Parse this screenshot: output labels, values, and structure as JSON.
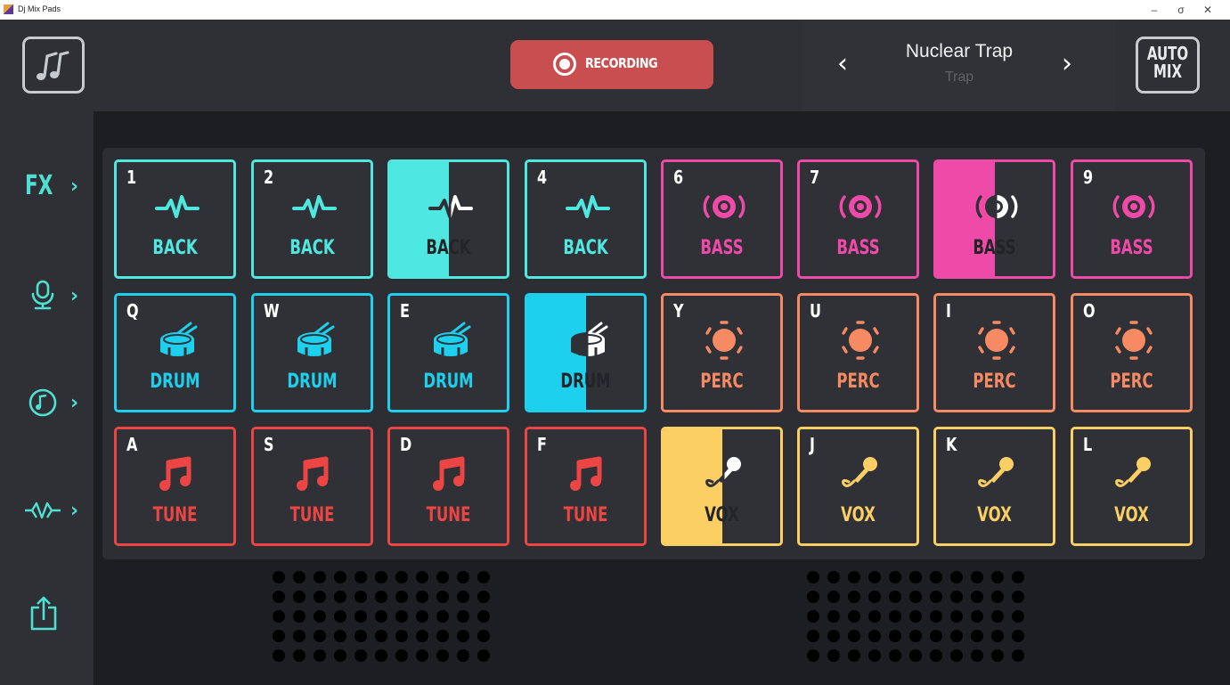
{
  "window": {
    "title": "Dj Mix Pads",
    "minimize": "–",
    "maximize": "σ",
    "close": "✕"
  },
  "topbar": {
    "logo_icon": "music-notes-icon",
    "record_label": "RECORDING",
    "record_icon": "record-icon",
    "track_title": "Nuclear Trap",
    "track_genre": "Trap",
    "prev_arrow": "‹",
    "next_arrow": "›",
    "automix_line1": "AUTO",
    "automix_line2": "MIX"
  },
  "sidebar": {
    "fx_label": "FX",
    "chevron": "›",
    "items": [
      "fx",
      "microphone-icon",
      "music-note-icon",
      "waveform-icon",
      "share-icon"
    ]
  },
  "colors": {
    "back": "#4ee8e0",
    "bass": "#f04aa8",
    "drum": "#1cd0ee",
    "perc": "#f58a63",
    "tune": "#ec4544",
    "vox": "#fbcf64"
  },
  "pads": [
    {
      "key": "1",
      "label": "BACK",
      "kind": "back",
      "active": false
    },
    {
      "key": "2",
      "label": "BACK",
      "kind": "back",
      "active": false
    },
    {
      "key": "",
      "label": "BACK",
      "kind": "back",
      "active": true
    },
    {
      "key": "4",
      "label": "BACK",
      "kind": "back",
      "active": false
    },
    {
      "key": "6",
      "label": "BASS",
      "kind": "bass",
      "active": false
    },
    {
      "key": "7",
      "label": "BASS",
      "kind": "bass",
      "active": false
    },
    {
      "key": "",
      "label": "BASS",
      "kind": "bass",
      "active": true
    },
    {
      "key": "9",
      "label": "BASS",
      "kind": "bass",
      "active": false
    },
    {
      "key": "Q",
      "label": "DRUM",
      "kind": "drum",
      "active": false
    },
    {
      "key": "W",
      "label": "DRUM",
      "kind": "drum",
      "active": false
    },
    {
      "key": "E",
      "label": "DRUM",
      "kind": "drum",
      "active": false
    },
    {
      "key": "",
      "label": "DRUM",
      "kind": "drum",
      "active": true
    },
    {
      "key": "Y",
      "label": "PERC",
      "kind": "perc",
      "active": false
    },
    {
      "key": "U",
      "label": "PERC",
      "kind": "perc",
      "active": false
    },
    {
      "key": "I",
      "label": "PERC",
      "kind": "perc",
      "active": false
    },
    {
      "key": "O",
      "label": "PERC",
      "kind": "perc",
      "active": false
    },
    {
      "key": "A",
      "label": "TUNE",
      "kind": "tune",
      "active": false
    },
    {
      "key": "S",
      "label": "TUNE",
      "kind": "tune",
      "active": false
    },
    {
      "key": "D",
      "label": "TUNE",
      "kind": "tune",
      "active": false
    },
    {
      "key": "F",
      "label": "TUNE",
      "kind": "tune",
      "active": false
    },
    {
      "key": "",
      "label": "VOX",
      "kind": "vox",
      "active": true
    },
    {
      "key": "J",
      "label": "VOX",
      "kind": "vox",
      "active": false
    },
    {
      "key": "K",
      "label": "VOX",
      "kind": "vox",
      "active": false
    },
    {
      "key": "L",
      "label": "VOX",
      "kind": "vox",
      "active": false
    }
  ]
}
